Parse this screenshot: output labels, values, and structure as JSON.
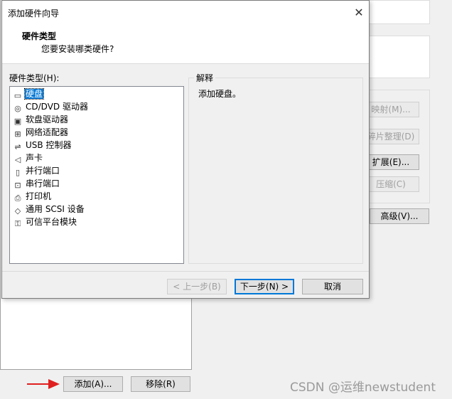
{
  "background": {
    "buttons": {
      "mapping": "映射(M)...",
      "defrag": "碎片整理(D)",
      "expand": "扩展(E)...",
      "compress": "压缩(C)",
      "advanced": "高级(V)...",
      "add": "添加(A)...",
      "remove": "移除(R)"
    },
    "watermark": "CSDN @运维newstudent"
  },
  "dialog": {
    "title": "添加硬件向导",
    "close_glyph": "✕",
    "header_title": "硬件类型",
    "header_subtitle": "您要安装哪类硬件?",
    "list_label": "硬件类型(H):",
    "items": [
      {
        "label": "硬盘",
        "icon": "hard-disk-icon",
        "glyph": "▭"
      },
      {
        "label": "CD/DVD 驱动器",
        "icon": "cd-dvd-icon",
        "glyph": "◎"
      },
      {
        "label": "软盘驱动器",
        "icon": "floppy-icon",
        "glyph": "▣"
      },
      {
        "label": "网络适配器",
        "icon": "network-adapter-icon",
        "glyph": "⊞"
      },
      {
        "label": "USB 控制器",
        "icon": "usb-icon",
        "glyph": "⇌"
      },
      {
        "label": "声卡",
        "icon": "speaker-icon",
        "glyph": "◁"
      },
      {
        "label": "并行端口",
        "icon": "parallel-port-icon",
        "glyph": "▯"
      },
      {
        "label": "串行端口",
        "icon": "serial-port-icon",
        "glyph": "⊡"
      },
      {
        "label": "打印机",
        "icon": "printer-icon",
        "glyph": "⎙"
      },
      {
        "label": "通用 SCSI 设备",
        "icon": "scsi-icon",
        "glyph": "◇"
      },
      {
        "label": "可信平台模块",
        "icon": "tpm-icon",
        "glyph": "⚿"
      }
    ],
    "selected_index": 0,
    "explain_legend": "解释",
    "explain_text": "添加硬盘。",
    "buttons": {
      "back": "< 上一步(B)",
      "next": "下一步(N) >",
      "cancel": "取消"
    }
  },
  "colors": {
    "selection": "#0078d7",
    "arrow": "#e02020"
  }
}
